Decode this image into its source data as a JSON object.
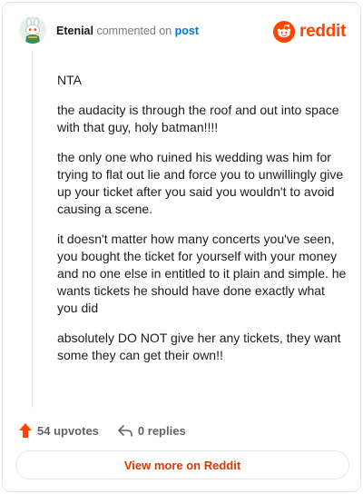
{
  "comment": {
    "author": "Etenial",
    "action_text": "commented on",
    "post_link_text": "post",
    "avatar_icon": "snoo-avatar-icon",
    "paragraphs": [
      "NTA",
      "the audacity is through the roof and out into space with that guy, holy batman!!!!",
      "the only one who ruined his wedding was him for trying to flat out lie and force you to unwillingly give up your ticket after you said you wouldn't to avoid causing a scene.",
      "it doesn't matter how many concerts you've seen, you bought the ticket for yourself with your money and no one else in entitled to it plain and simple. he wants tickets he should have done exactly what you did",
      "absolutely DO NOT give her any tickets, they want some they can get their own!!"
    ],
    "upvotes_label": "54 upvotes",
    "replies_label": "0 replies"
  },
  "brand": {
    "name": "reddit",
    "icon": "reddit-logo-icon",
    "color": "#ff4500"
  },
  "footer": {
    "view_more_label": "View more on Reddit"
  },
  "colors": {
    "link": "#0079d3",
    "upvote": "#ff4500",
    "view_more_text": "#d93900"
  }
}
